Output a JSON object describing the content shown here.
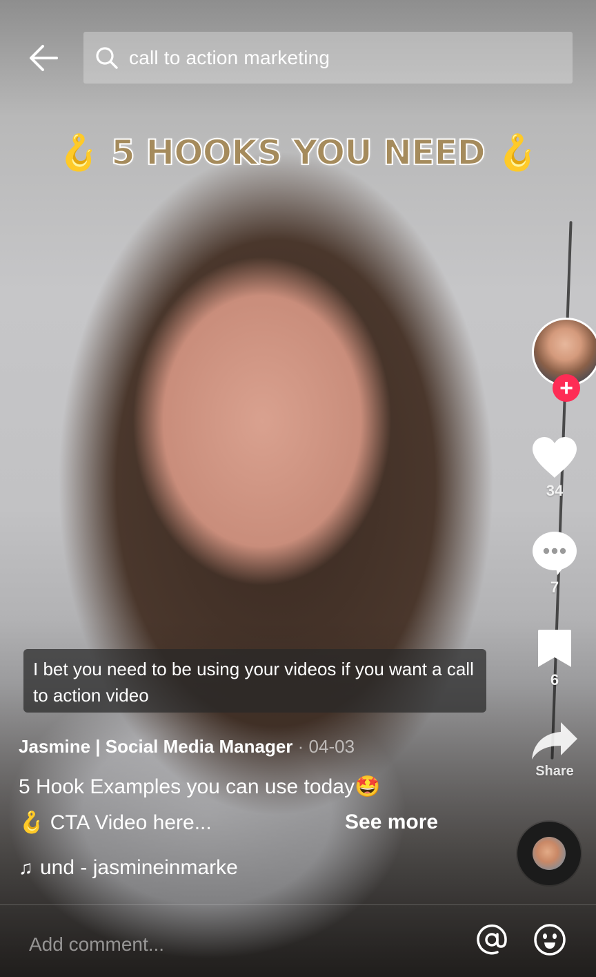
{
  "search": {
    "query": "call to action marketing"
  },
  "video": {
    "overlay_title": "5 HOOKS YOU NEED",
    "overlay_title_emoji": "🪝",
    "subtitle": "I bet you need to be using your videos if you want a call to action video"
  },
  "rail": {
    "follow_label": "+",
    "likes": "34",
    "comments": "7",
    "saves": "6",
    "share_label": "Share"
  },
  "post": {
    "author": "Jasmine | Social Media Manager",
    "date_separator": " · ",
    "date": "04-03",
    "description_line1": "5 Hook Examples you can use today🤩",
    "description_line2_emoji": "🪝",
    "description_line2": " CTA Video here...",
    "see_more": "See more",
    "music_note": "♫",
    "sound": "und - jasmineinmarke"
  },
  "comment_bar": {
    "placeholder": "Add comment..."
  },
  "colors": {
    "follow_badge": "#fe2c55",
    "title_gold": "#a58b5c"
  }
}
